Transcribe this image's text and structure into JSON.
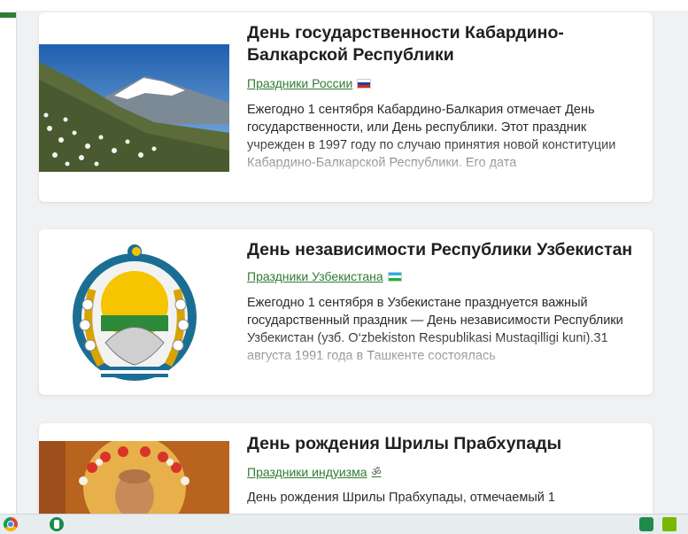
{
  "colors": {
    "accent_green": "#2e7d32",
    "card_bg": "#ffffff",
    "page_bg": "#f0f1f2"
  },
  "cards": [
    {
      "title": "День государственности Кабардино-Балкарской Республики",
      "category": "Праздники России",
      "flag": "russia-flag",
      "excerpt": "Ежегодно 1 сентября Кабардино-Балкария отмечает День государственности, или День республики. Этот праздник учрежден в 1997 году по случаю принятия новой конституции Кабардино-Балкарской Республики. Его дата",
      "image": "mountain-landscape-image"
    },
    {
      "title": "День независимости Республики Узбекистан",
      "category": "Праздники Узбекистана",
      "flag": "uzbekistan-flag",
      "excerpt": "Ежегодно 1 сентября в Узбекистане празднуется важный государственный праздник — День независимости Республики Узбекистан (узб. O‘zbekiston Respublikasi Mustaqilligi kuni).31 августа 1991 года в Ташкенте состоялась",
      "image": "uzbekistan-emblem-image"
    },
    {
      "title": "День рождения Шрилы Прабхупады",
      "category": "Праздники индуизма",
      "flag": "om-icon",
      "excerpt": "День рождения Шрилы Прабхупады, отмечаемый 1",
      "image": "prabhupada-portrait-image"
    }
  ],
  "taskbar": {
    "icons": [
      "chrome-icon",
      "app-icon",
      "shield-icon",
      "nvidia-icon"
    ]
  }
}
